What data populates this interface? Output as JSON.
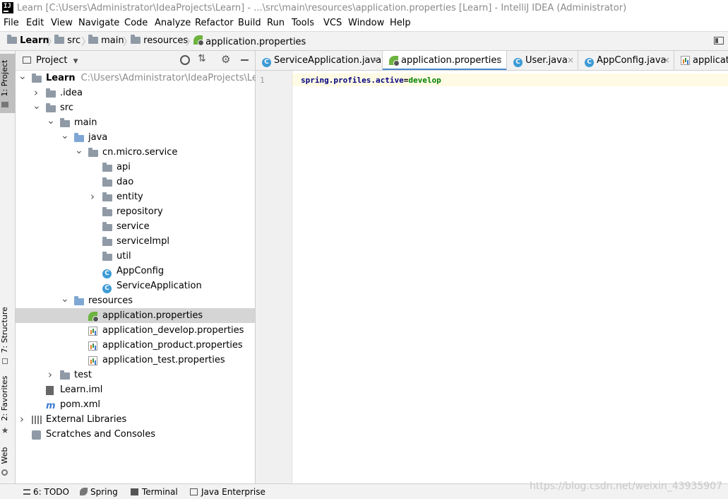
{
  "window": {
    "title": "Learn [C:\\Users\\Administrator\\IdeaProjects\\Learn] - ...\\src\\main\\resources\\application.properties [Learn] - IntelliJ IDEA (Administrator)",
    "logo_text": "IJ"
  },
  "menu": [
    "File",
    "Edit",
    "View",
    "Navigate",
    "Code",
    "Analyze",
    "Refactor",
    "Build",
    "Run",
    "Tools",
    "VCS",
    "Window",
    "Help"
  ],
  "breadcrumb": [
    "Learn",
    "src",
    "main",
    "resources",
    "application.properties"
  ],
  "left_strip": {
    "project": "1: Project",
    "structure": "7: Structure",
    "favorites": "2: Favorites",
    "web": "Web"
  },
  "project_panel": {
    "title": "Project",
    "tree": [
      {
        "label": "Learn",
        "path": "C:\\Users\\Administrator\\IdeaProjects\\Learn",
        "icon": "folder-icon",
        "indent": 0,
        "arrow": "open"
      },
      {
        "label": ".idea",
        "icon": "folder-icon",
        "indent": 1,
        "arrow": "closed"
      },
      {
        "label": "src",
        "icon": "folder-icon",
        "indent": 1,
        "arrow": "open"
      },
      {
        "label": "main",
        "icon": "folder-icon",
        "indent": 2,
        "arrow": "open"
      },
      {
        "label": "java",
        "icon": "source-folder-icon",
        "indent": 3,
        "arrow": "open"
      },
      {
        "label": "cn.micro.service",
        "icon": "package-icon",
        "indent": 4,
        "arrow": "open"
      },
      {
        "label": "api",
        "icon": "package-icon",
        "indent": 5,
        "arrow": "none"
      },
      {
        "label": "dao",
        "icon": "package-icon",
        "indent": 5,
        "arrow": "none"
      },
      {
        "label": "entity",
        "icon": "package-icon",
        "indent": 5,
        "arrow": "closed"
      },
      {
        "label": "repository",
        "icon": "package-icon",
        "indent": 5,
        "arrow": "none"
      },
      {
        "label": "service",
        "icon": "package-icon",
        "indent": 5,
        "arrow": "none"
      },
      {
        "label": "serviceImpl",
        "icon": "package-icon",
        "indent": 5,
        "arrow": "none"
      },
      {
        "label": "util",
        "icon": "package-icon",
        "indent": 5,
        "arrow": "none"
      },
      {
        "label": "AppConfig",
        "icon": "class-icon",
        "indent": 5,
        "arrow": "none"
      },
      {
        "label": "ServiceApplication",
        "icon": "class-icon",
        "indent": 5,
        "arrow": "none"
      },
      {
        "label": "resources",
        "icon": "resources-folder-icon",
        "indent": 3,
        "arrow": "open"
      },
      {
        "label": "application.properties",
        "icon": "spring-properties-icon",
        "indent": 4,
        "arrow": "none",
        "selected": true
      },
      {
        "label": "application_develop.properties",
        "icon": "properties-icon",
        "indent": 4,
        "arrow": "none"
      },
      {
        "label": "application_product.properties",
        "icon": "properties-icon",
        "indent": 4,
        "arrow": "none"
      },
      {
        "label": "application_test.properties",
        "icon": "properties-icon",
        "indent": 4,
        "arrow": "none"
      },
      {
        "label": "test",
        "icon": "folder-icon",
        "indent": 2,
        "arrow": "closed"
      },
      {
        "label": "Learn.iml",
        "icon": "iml-file-icon",
        "indent": 1,
        "arrow": "none"
      },
      {
        "label": "pom.xml",
        "icon": "maven-icon",
        "indent": 1,
        "arrow": "none"
      },
      {
        "label": "External Libraries",
        "icon": "libraries-icon",
        "indent": 0,
        "arrow": "closed"
      },
      {
        "label": "Scratches and Consoles",
        "icon": "scratches-icon",
        "indent": 0,
        "arrow": "none"
      }
    ]
  },
  "tabs": [
    {
      "label": "ServiceApplication.java",
      "icon": "class-icon",
      "active": false
    },
    {
      "label": "application.properties",
      "icon": "spring-properties-icon",
      "active": true
    },
    {
      "label": "User.java",
      "icon": "class-icon",
      "active": false
    },
    {
      "label": "AppConfig.java",
      "icon": "class-icon",
      "active": false
    },
    {
      "label": "applicatio",
      "icon": "properties-icon",
      "active": false
    }
  ],
  "editor": {
    "line_number": "1",
    "line": {
      "key": "spring.profiles.active",
      "eq": "=",
      "value": "develop"
    }
  },
  "bottom_tools": [
    {
      "label": "6: TODO",
      "icon": "todo-icon"
    },
    {
      "label": "Spring",
      "icon": "spring-icon"
    },
    {
      "label": "Terminal",
      "icon": "terminal-icon"
    },
    {
      "label": "Java Enterprise",
      "icon": "java-enterprise-icon"
    }
  ],
  "watermark": "https://blog.csdn.net/weixin_43935907",
  "colors": {
    "accent": "#4a88c7",
    "selection": "#d5d5d5",
    "current_line": "#fffae3",
    "code_key": "#000080",
    "code_value": "#008000"
  }
}
